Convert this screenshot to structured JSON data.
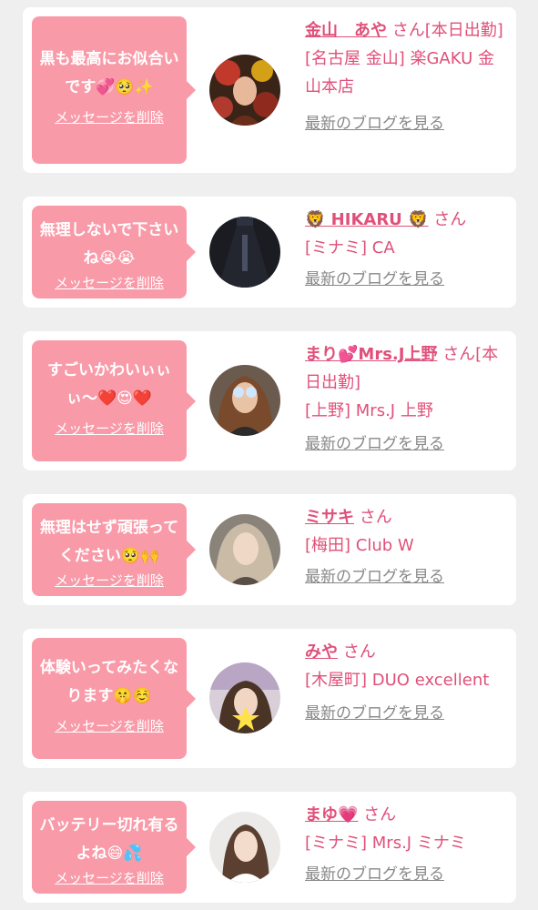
{
  "colors": {
    "page_bg": "#efefef",
    "card_bg": "#ffffff",
    "bubble_bg": "#f99aa8",
    "accent": "#e0507a",
    "muted": "#888888"
  },
  "items": [
    {
      "message": "黒も最高にお似合いです💞🥺✨",
      "delete_label": "メッセージを削除",
      "name": "金山　あや",
      "suffix": "さん[本日出勤]",
      "shop": "[名古屋 金山] 楽GAKU 金山本店",
      "blog_label": "最新のブログを見る",
      "avatar_icon": "avatar-photo"
    },
    {
      "message": "無理しないで下さいね😭😭",
      "delete_label": "メッセージを削除",
      "name": "🦁 HIKARU 🦁",
      "suffix": "さん",
      "shop": "[ミナミ] CA",
      "blog_label": "最新のブログを見る",
      "avatar_icon": "avatar-photo"
    },
    {
      "message": "すごいかわいぃぃぃ〜❤️😍❤️",
      "delete_label": "メッセージを削除",
      "name": "まり💕Mrs.J上野",
      "suffix": "さん[本日出勤]",
      "shop": "[上野] Mrs.J 上野",
      "blog_label": "最新のブログを見る",
      "avatar_icon": "avatar-photo"
    },
    {
      "message": "無理はせず頑張ってください🥺🙌",
      "delete_label": "メッセージを削除",
      "name": "ミサキ",
      "suffix": "さん",
      "shop": "[梅田] Club W",
      "blog_label": "最新のブログを見る",
      "avatar_icon": "avatar-photo"
    },
    {
      "message": "体験いってみたくなります🤫☺️",
      "delete_label": "メッセージを削除",
      "name": "みや",
      "suffix": "さん",
      "shop": "[木屋町] DUO excellent",
      "blog_label": "最新のブログを見る",
      "avatar_icon": "avatar-photo"
    },
    {
      "message": "バッテリー切れ有るよね😄💦",
      "delete_label": "メッセージを削除",
      "name": "まゆ💗",
      "suffix": "さん",
      "shop": "[ミナミ] Mrs.J ミナミ",
      "blog_label": "最新のブログを見る",
      "avatar_icon": "avatar-photo"
    }
  ]
}
